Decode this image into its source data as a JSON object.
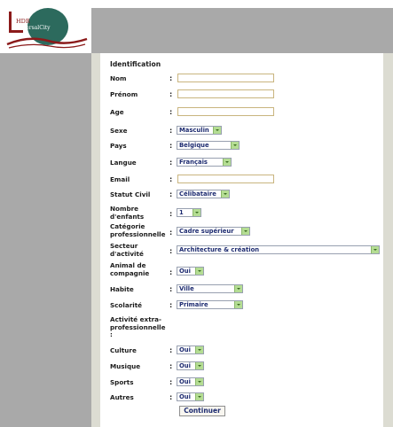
{
  "logo": {
    "line1": "HDR",
    "line2": "UniversalCity",
    "letter": "U"
  },
  "form": {
    "section_title": "Identification",
    "fields": [
      {
        "label": "Nom",
        "value": ""
      },
      {
        "label": "Prénom",
        "value": ""
      },
      {
        "label": "Age",
        "value": ""
      },
      {
        "label": "Sexe",
        "value": "Masculin"
      },
      {
        "label": "Pays",
        "value": "Belgique"
      },
      {
        "label": "Langue",
        "value": "Français"
      },
      {
        "label": "Email",
        "value": ""
      },
      {
        "label": "Statut Civil",
        "value": "Célibataire"
      },
      {
        "label": "Nombre\nd'enfants",
        "value": "1"
      },
      {
        "label": "Catégorie\nprofessionnelle",
        "value": "Cadre supérieur"
      },
      {
        "label": "Secteur\nd'activité",
        "value": "Architecture & création"
      },
      {
        "label": "Animal de\ncompagnie",
        "value": "Oui"
      },
      {
        "label": "Habite",
        "value": "Ville"
      },
      {
        "label": "Scolarité",
        "value": "Primaire"
      },
      {
        "label": "Activité extra-\nprofessionnelle\n:"
      },
      {
        "label": "Culture",
        "value": "Oui"
      },
      {
        "label": "Musique",
        "value": "Oui"
      },
      {
        "label": "Sports",
        "value": "Oui"
      },
      {
        "label": "Autres",
        "value": "Oui"
      }
    ],
    "colon": ":",
    "continue_label": "Continuer"
  },
  "colors": {
    "sidebar_gray": "#a9a9a9",
    "beige_border": "#dcdcd2",
    "select_text_navy": "#1d2b70",
    "logo_teal": "#2c6a5d",
    "logo_red": "#8b1a1a"
  }
}
